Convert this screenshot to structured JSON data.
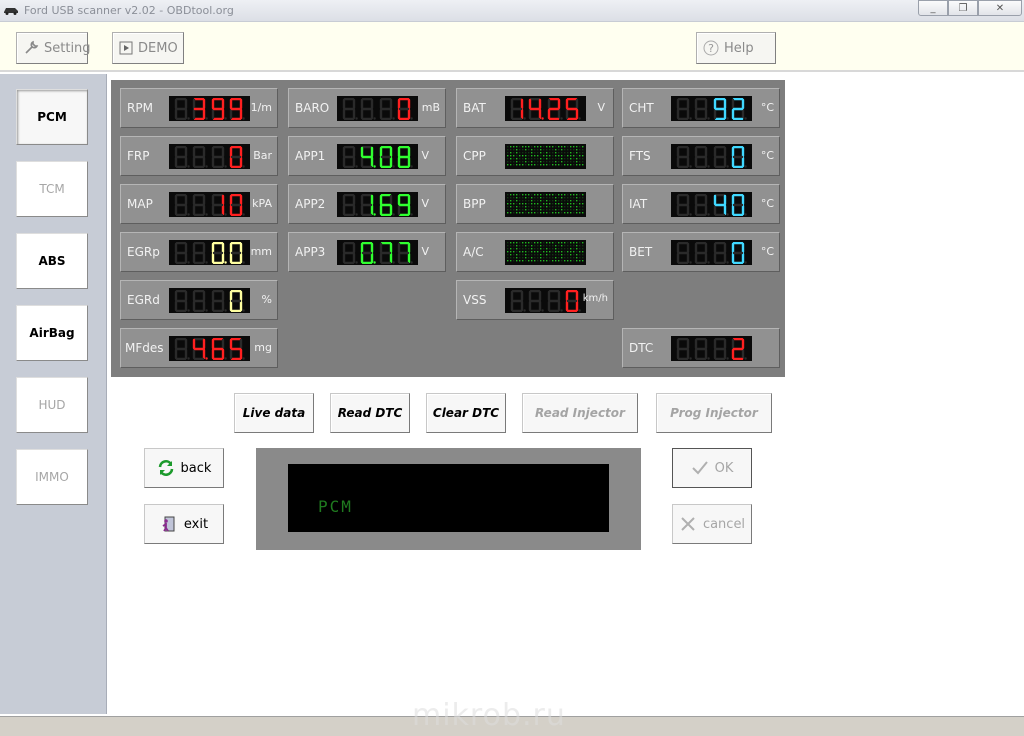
{
  "window": {
    "title": "Ford USB scanner v2.02 - OBDtool.org",
    "minimize_glyph": "_",
    "restore_glyph": "❐",
    "close_glyph": "✕"
  },
  "toolbar": {
    "setting_label": "Setting",
    "demo_label": "DEMO",
    "help_label": "Help"
  },
  "sidebar": {
    "items": [
      {
        "label": "PCM",
        "state": "active"
      },
      {
        "label": "TCM",
        "state": "disabled"
      },
      {
        "label": "ABS",
        "state": "enabled"
      },
      {
        "label": "AirBag",
        "state": "enabled"
      },
      {
        "label": "HUD",
        "state": "disabled"
      },
      {
        "label": "IMMO",
        "state": "disabled"
      }
    ]
  },
  "gauges": {
    "rpm": {
      "label": "RPM",
      "unit": "1/m",
      "value": "399",
      "color": "#ff2020"
    },
    "frp": {
      "label": "FRP",
      "unit": "Bar",
      "value": "0",
      "color": "#ff2020"
    },
    "map": {
      "label": "MAP",
      "unit": "kPA",
      "value": "10",
      "color": "#ff2020"
    },
    "egrp": {
      "label": "EGRp",
      "unit": "mm",
      "value": "0.0",
      "color": "#ffffa0"
    },
    "egrd": {
      "label": "EGRd",
      "unit": "%",
      "value": "0",
      "color": "#ffffa0"
    },
    "mfdes": {
      "label": "MFdes",
      "unit": "mg",
      "value": "4.65",
      "color": "#ff2020"
    },
    "baro": {
      "label": "BARO",
      "unit": "mB",
      "value": "0",
      "color": "#ff2020"
    },
    "app1": {
      "label": "APP1",
      "unit": "V",
      "value": "4.08",
      "color": "#30ff30"
    },
    "app2": {
      "label": "APP2",
      "unit": "V",
      "value": "1.69",
      "color": "#30ff30"
    },
    "app3": {
      "label": "APP3",
      "unit": "V",
      "value": "0.77",
      "color": "#30ff30"
    },
    "bat": {
      "label": "BAT",
      "unit": "V",
      "value": "14.25",
      "color": "#ff2020"
    },
    "cpp": {
      "label": "CPP"
    },
    "bpp": {
      "label": "BPP"
    },
    "ac": {
      "label": "A/C"
    },
    "vss": {
      "label": "VSS",
      "unit": "km/h",
      "value": "0",
      "color": "#ff2020"
    },
    "cht": {
      "label": "CHT",
      "unit": "°C",
      "value": "92",
      "color": "#40d8ff"
    },
    "fts": {
      "label": "FTS",
      "unit": "°C",
      "value": "0",
      "color": "#40d8ff"
    },
    "iat": {
      "label": "IAT",
      "unit": "°C",
      "value": "40",
      "color": "#40d8ff"
    },
    "bet": {
      "label": "BET",
      "unit": "°C",
      "value": "0",
      "color": "#40d8ff"
    },
    "dtc": {
      "label": "DTC",
      "value": "2",
      "color": "#ff2020"
    }
  },
  "colors": {
    "segment_off": "#2a2a2a",
    "dot_matrix": "#1fb81f"
  },
  "actions": {
    "live_data": "Live data",
    "read_dtc": "Read DTC",
    "clear_dtc": "Clear DTC",
    "read_injector": "Read Injector",
    "prog_injector": "Prog Injector",
    "back": "back",
    "exit": "exit",
    "ok": "OK",
    "cancel": "cancel"
  },
  "monitor": {
    "text": "PCM"
  },
  "watermark": "mikrob.ru"
}
